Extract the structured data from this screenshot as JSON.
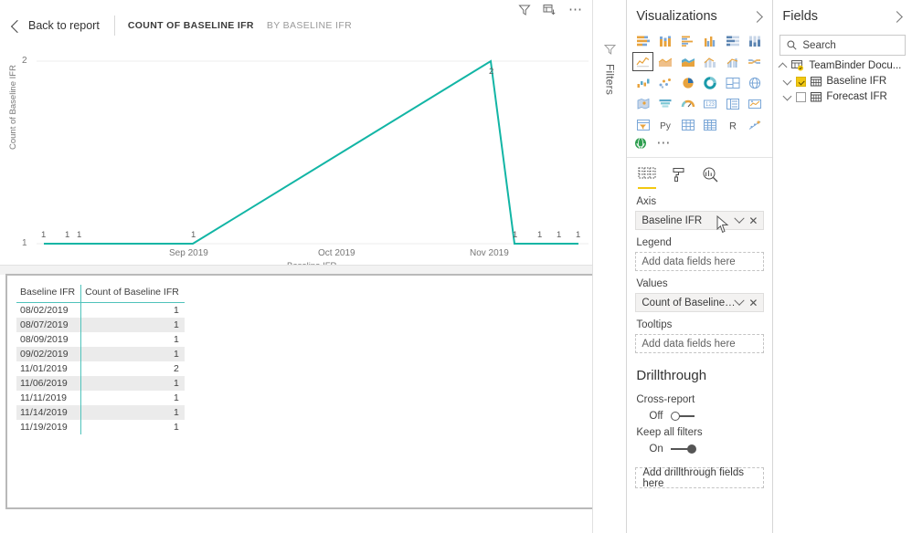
{
  "report_header": {
    "back_label": "Back to report",
    "title": "COUNT OF BASELINE IFR",
    "subtitle": "BY BASELINE IFR",
    "icons": [
      "filter-icon",
      "drill-icon",
      "more-options-icon"
    ]
  },
  "chart_data": {
    "type": "line",
    "title": "Count of Baseline IFR by Baseline IFR",
    "xlabel": "Baseline IFR",
    "ylabel": "Count of Baseline IFR",
    "ylim": [
      1,
      2
    ],
    "ytick_labels": [
      "1",
      "2"
    ],
    "xtick_labels": [
      "Sep 2019",
      "Oct 2019",
      "Nov 2019"
    ],
    "grid": true,
    "line_color": "#12B5A5",
    "categories": [
      "08/02/2019",
      "08/07/2019",
      "08/09/2019",
      "09/02/2019",
      "11/01/2019",
      "11/06/2019",
      "11/11/2019",
      "11/14/2019",
      "11/19/2019"
    ],
    "values": [
      1,
      1,
      1,
      1,
      2,
      1,
      1,
      1,
      1
    ],
    "data_labels": [
      "1",
      "1",
      "1",
      "1",
      "2",
      "1",
      "1",
      "1",
      "1"
    ]
  },
  "data_table": {
    "columns": [
      "Baseline IFR",
      "Count of Baseline IFR"
    ],
    "rows": [
      [
        "08/02/2019",
        "1"
      ],
      [
        "08/07/2019",
        "1"
      ],
      [
        "08/09/2019",
        "1"
      ],
      [
        "09/02/2019",
        "1"
      ],
      [
        "11/01/2019",
        "2"
      ],
      [
        "11/06/2019",
        "1"
      ],
      [
        "11/11/2019",
        "1"
      ],
      [
        "11/14/2019",
        "1"
      ],
      [
        "11/19/2019",
        "1"
      ]
    ]
  },
  "filters_pane": {
    "label": "Filters"
  },
  "visualizations": {
    "title": "Visualizations",
    "selected_index": 6,
    "icons": [
      "stacked-bar-chart-icon",
      "stacked-column-chart-icon",
      "clustered-bar-chart-icon",
      "clustered-column-chart-icon",
      "100-stacked-bar-chart-icon",
      "100-stacked-column-chart-icon",
      "line-chart-icon",
      "area-chart-icon",
      "stacked-area-chart-icon",
      "line-stacked-column-chart-icon",
      "line-clustered-column-chart-icon",
      "ribbon-chart-icon",
      "waterfall-chart-icon",
      "scatter-chart-icon",
      "pie-chart-icon",
      "donut-chart-icon",
      "treemap-icon",
      "map-icon",
      "filled-map-icon",
      "funnel-chart-icon",
      "gauge-chart-icon",
      "card-icon",
      "multi-row-card-icon",
      "kpi-icon",
      "slicer-icon",
      "python-visual-icon",
      "table-icon",
      "matrix-icon",
      "r-script-visual-icon",
      "key-influencers-icon"
    ],
    "extra_icons": [
      "arcgis-maps-icon",
      "more-visuals-icon"
    ],
    "well_tabs": [
      "fields-tab",
      "format-tab",
      "analytics-tab"
    ],
    "well_tab_selected": 0,
    "wells": [
      {
        "label": "Axis",
        "value": "Baseline IFR",
        "placeholder": "Add data fields here",
        "filled": true
      },
      {
        "label": "Legend",
        "value": "",
        "placeholder": "Add data fields here",
        "filled": false
      },
      {
        "label": "Values",
        "value": "Count of Baseline IFR",
        "placeholder": "Add data fields here",
        "filled": true
      },
      {
        "label": "Tooltips",
        "value": "",
        "placeholder": "Add data fields here",
        "filled": false
      }
    ],
    "drillthrough": {
      "title": "Drillthrough",
      "cross_report_label": "Cross-report",
      "cross_report_state": "Off",
      "keep_filters_label": "Keep all filters",
      "keep_filters_state": "On",
      "add_fields_placeholder": "Add drillthrough fields here"
    }
  },
  "fields": {
    "title": "Fields",
    "search_placeholder": "Search",
    "table_name": "TeamBinder Docu...",
    "items": [
      {
        "name": "Baseline IFR",
        "checked": true
      },
      {
        "name": "Forecast IFR",
        "checked": false
      }
    ]
  },
  "colors": {
    "accent_teal": "#12B5A5",
    "accent_yellow": "#F2C811"
  }
}
